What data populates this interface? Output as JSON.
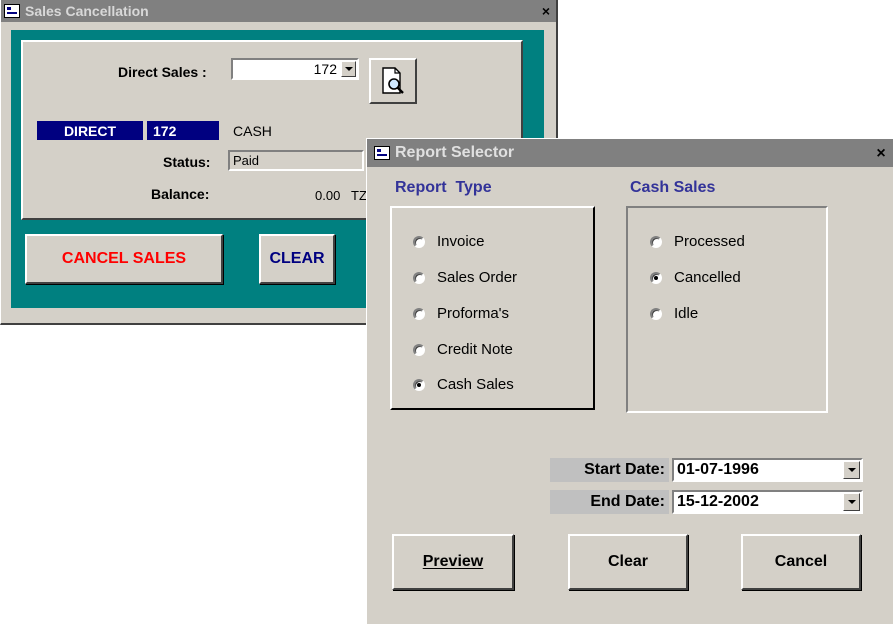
{
  "sales_cancellation": {
    "title": "Sales Cancellation",
    "close_glyph": "×",
    "direct_sales_label": "Direct Sales :",
    "direct_sales_value": "172",
    "preview_icon": "document-magnifier-icon",
    "type_badge": "DIRECT",
    "number_badge": "172",
    "payment_mode": "CASH",
    "status_label": "Status:",
    "status_value": "Paid",
    "balance_label": "Balance:",
    "balance_value": "0.00",
    "balance_currency": "TZ",
    "cancel_sales_label": "CANCEL SALES",
    "clear_label": "CLEAR",
    "colors": {
      "panel_bg": "#008080",
      "badge_bg": "#000080",
      "cancel_text": "#ff0000",
      "clear_text": "#000080"
    }
  },
  "report_selector": {
    "title": "Report Selector",
    "close_glyph": "×",
    "report_type_header": "Report  Type",
    "report_types": [
      {
        "label": "Invoice",
        "selected": false
      },
      {
        "label": "Sales Order",
        "selected": false
      },
      {
        "label": "Proforma's",
        "selected": false
      },
      {
        "label": "Credit Note",
        "selected": false
      },
      {
        "label": "Cash Sales",
        "selected": true
      }
    ],
    "cash_sales_header": "Cash Sales",
    "cash_sales_options": [
      {
        "label": "Processed",
        "selected": false
      },
      {
        "label": "Cancelled",
        "selected": true
      },
      {
        "label": "Idle",
        "selected": false
      }
    ],
    "start_date_label": "Start Date:",
    "start_date_value": "01-07-1996",
    "end_date_label": "End Date:",
    "end_date_value": "15-12-2002",
    "preview_label": "Preview",
    "clear_label": "Clear",
    "cancel_label": "Cancel",
    "colors": {
      "header_text": "#333399"
    }
  }
}
